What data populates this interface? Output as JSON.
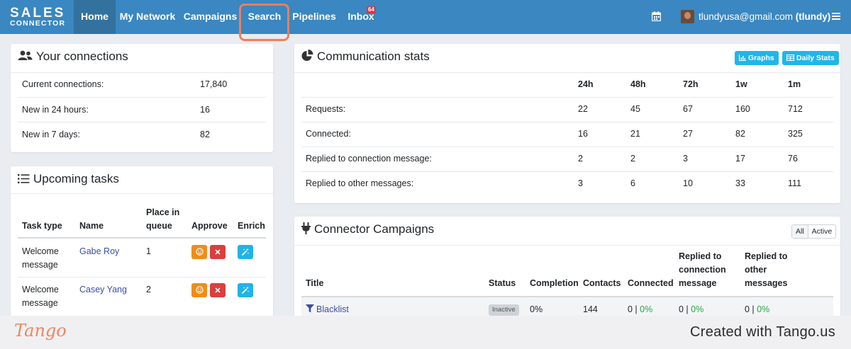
{
  "nav": {
    "logo_line1": "SALES",
    "logo_line2": "CONNECTOR",
    "items": [
      {
        "label": "Home"
      },
      {
        "label": "My Network"
      },
      {
        "label": "Campaigns"
      },
      {
        "label": "Search"
      },
      {
        "label": "Pipelines"
      },
      {
        "label": "Inbox"
      }
    ],
    "inbox_badge": "64",
    "user_email": "tlundyusa@gmail.com",
    "user_handle": "(tlundy)",
    "icons": [
      "calendar-icon",
      "menu-icon"
    ]
  },
  "connections": {
    "title": "Your connections",
    "rows": [
      {
        "label": "Current connections:",
        "value": "17,840"
      },
      {
        "label": "New in 24 hours:",
        "value": "16"
      },
      {
        "label": "New in 7 days:",
        "value": "82"
      }
    ]
  },
  "tasks": {
    "title": "Upcoming tasks",
    "headers": {
      "type": "Task type",
      "name": "Name",
      "queue": "Place in queue",
      "approve": "Approve",
      "enrich": "Enrich"
    },
    "rows": [
      {
        "type": "Welcome message",
        "name": "Gabe Roy",
        "queue": "1"
      },
      {
        "type": "Welcome message",
        "name": "Casey Yang",
        "queue": "2"
      }
    ]
  },
  "stats": {
    "title": "Communication stats",
    "graphs_label": "Graphs",
    "daily_label": "Daily Stats",
    "columns": [
      "24h",
      "48h",
      "72h",
      "1w",
      "1m"
    ],
    "rows": [
      {
        "label": "Requests:",
        "values": [
          "22",
          "45",
          "67",
          "160",
          "712"
        ]
      },
      {
        "label": "Connected:",
        "values": [
          "16",
          "21",
          "27",
          "82",
          "325"
        ]
      },
      {
        "label": "Replied to connection message:",
        "values": [
          "2",
          "2",
          "3",
          "17",
          "76"
        ]
      },
      {
        "label": "Replied to other messages:",
        "values": [
          "3",
          "6",
          "10",
          "33",
          "111"
        ]
      }
    ]
  },
  "campaigns": {
    "title": "Connector Campaigns",
    "filter_all": "All",
    "filter_active": "Active",
    "headers": {
      "title": "Title",
      "status": "Status",
      "completion": "Completion",
      "contacts": "Contacts",
      "connected": "Connected",
      "replied_conn_1": "Replied to",
      "replied_conn_2": "connection",
      "replied_conn_3": "message",
      "replied_other_1": "Replied to",
      "replied_other_2": "other",
      "replied_other_3": "messages"
    },
    "rows": [
      {
        "title": "Blacklist",
        "status": "Inactive",
        "completion": "0%",
        "contacts": "144",
        "connected": "0",
        "connected_pct": "0%",
        "replied_conn": "0",
        "replied_conn_pct": "0%",
        "replied_other": "0",
        "replied_other_pct": "0%"
      }
    ]
  },
  "footer": {
    "brand": "Tango",
    "created": "Created with Tango.us"
  },
  "colors": {
    "navbar": "#3a87c1",
    "accent_info": "#21b3e8",
    "highlight": "#ef7f5a",
    "link": "#3c4fa0",
    "success": "#28a745"
  }
}
